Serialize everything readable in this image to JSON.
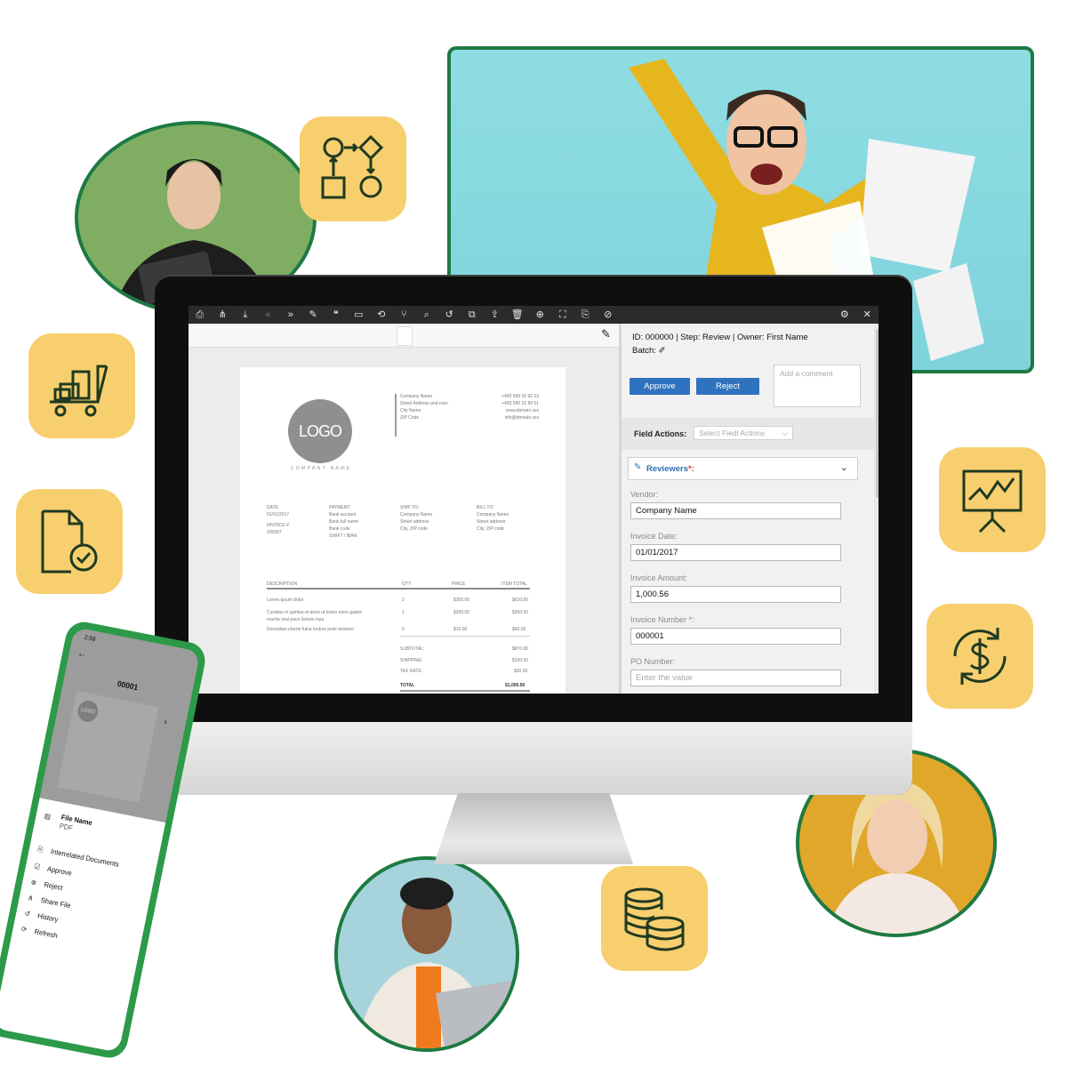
{
  "toolbar": {
    "icons": [
      "print-icon",
      "share-icon",
      "download-icon",
      "chevron-double-left-icon",
      "chevron-double-right-icon",
      "edit-icon",
      "comments-icon",
      "folder-icon",
      "rotate-icon",
      "split-icon",
      "search-icon",
      "history-icon",
      "merge-icon",
      "export-icon",
      "delete-icon",
      "target-icon",
      "fullscreen-icon",
      "bookmark-icon",
      "ban-icon"
    ],
    "glyphs": [
      "⎙",
      "⋔",
      "⤓",
      "«",
      "»",
      "✎",
      "❝",
      "▭",
      "⟲",
      "⑂",
      "⌕",
      "↺",
      "⧉",
      "⇪",
      "🗑",
      "⊕",
      "⛶",
      "⎘",
      "⊘"
    ],
    "settings_glyph": "⚙",
    "close_glyph": "✕"
  },
  "invoice": {
    "logo_text": "LOGO",
    "company_label": "COMPANY NAME",
    "address": [
      "Company Name",
      "Street Address and num",
      "City Name",
      "ZIP Code"
    ],
    "contact": [
      "+450 560 16 92 23",
      "+450 560 22 84 51",
      "www.domain.xxx",
      "info@domain.xxx"
    ],
    "date_label": "DATE",
    "date_value": "01/01/2017",
    "invoice_label": "INVOICE #:",
    "invoice_value": "100007",
    "payment_label": "PAYMENT:",
    "payment_lines": [
      "Bank account",
      "Bank full name",
      "Bank code",
      "SWIFT / IBAN"
    ],
    "ship_label": "SHIP TO:",
    "ship_lines": [
      "Company Name",
      "Street address",
      "City, ZIP code"
    ],
    "bill_label": "BILL TO:",
    "bill_lines": [
      "Company Name",
      "Street address",
      "City, ZIP code"
    ],
    "head_description": "DESCRIPTION",
    "head_qty": "QTY",
    "head_price": "PRICE",
    "head_total": "ITEM TOTAL",
    "rows": [
      {
        "desc": "Lorem ipsum dolor",
        "qty": "2",
        "price": "$305.00",
        "total": "$610.00"
      },
      {
        "desc": "Curabus et spiritus et amet ut lorem more gadeo mache reat pace lontum ispa",
        "qty": "1",
        "price": "$200.00",
        "total": "$200.00"
      },
      {
        "desc": "Doromites eturne fuina lontum jeste besterin",
        "qty": "6",
        "price": "$10.00",
        "total": "$60.00"
      }
    ],
    "subtotal_label": "SUBTOTAL:",
    "subtotal_value": "$870.00",
    "shipping_label": "SHIPPING:",
    "shipping_value": "$100.00",
    "tax_label": "TAX RATE:",
    "tax_value": "$30.56",
    "total_label": "TOTAL",
    "total_value": "$1,000.56"
  },
  "panel": {
    "meta": "ID: 000000 | Step: Review | Owner: First Name",
    "batch": "Batch: ✐",
    "approve": "Approve",
    "reject": "Reject",
    "comment_placeholder": "Add a comment",
    "field_actions_label": "Field Actions:",
    "field_actions_placeholder": "Select Fiedl Actions",
    "reviewers_label": "Reviewers",
    "reviewers_required": "*:",
    "fields": [
      {
        "label": "Vendor:",
        "value": "Company Name",
        "placeholder": ""
      },
      {
        "label": "Invoice Date:",
        "value": "01/01/2017",
        "placeholder": ""
      },
      {
        "label": "Invoice Amount:",
        "value": "1,000.56",
        "placeholder": ""
      },
      {
        "label": "Invoice Number *:",
        "value": "000001",
        "placeholder": ""
      },
      {
        "label": "PO Number:",
        "value": "",
        "placeholder": "Enter the value"
      }
    ]
  },
  "phone": {
    "time": "2:58",
    "doc_id": "00001",
    "logo_text": "LOGO",
    "file_name": "File Name",
    "file_type": "PDF",
    "menu": [
      "Interrelated Documents",
      "Approve",
      "Reject",
      "Share File",
      "History",
      "Refresh"
    ]
  },
  "colors": {
    "accent_green": "#1d7a42",
    "tile_yellow": "#f8cf6e",
    "button_blue": "#2f72bf",
    "toolbar": "#2b2b2b"
  }
}
